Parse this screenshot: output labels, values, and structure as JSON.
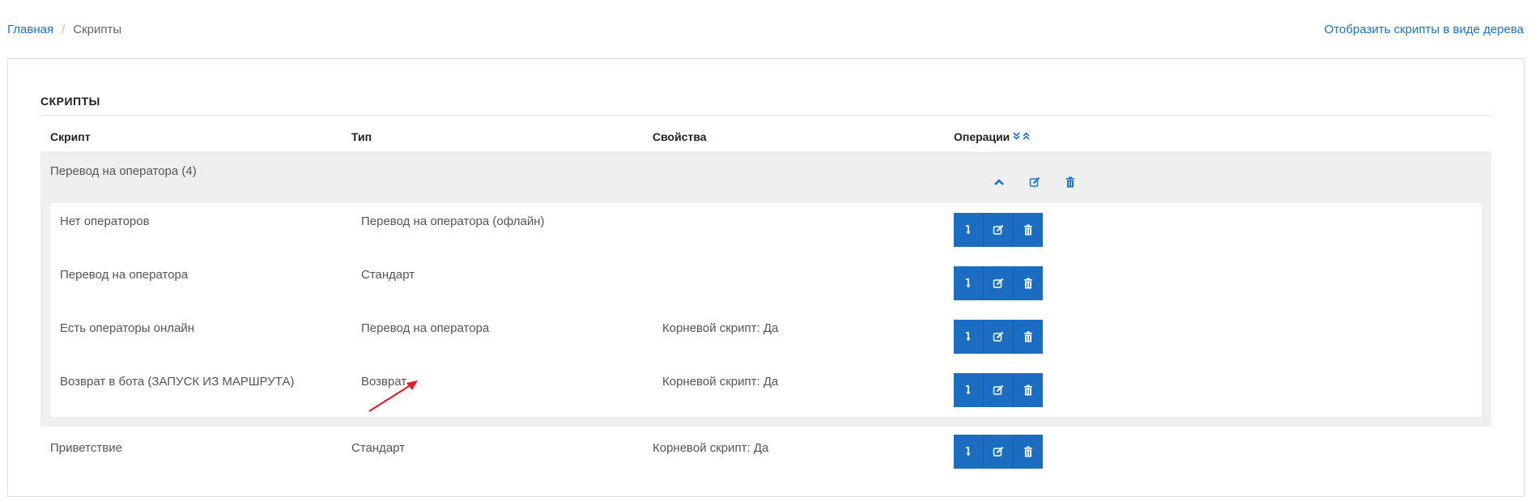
{
  "breadcrumb": {
    "home": "Главная",
    "current": "Скрипты"
  },
  "tree_link": "Отобразить скрипты в виде дерева",
  "card": {
    "title": "СКРИПТЫ"
  },
  "columns": {
    "script": "Скрипт",
    "type": "Тип",
    "properties": "Свойства",
    "operations": "Операции"
  },
  "group": {
    "name": "Перевод на оператора (4)",
    "children": [
      {
        "script": "Нет операторов",
        "type": "Перевод на оператора (офлайн)",
        "properties": ""
      },
      {
        "script": "Перевод на оператора",
        "type": "Стандарт",
        "properties": ""
      },
      {
        "script": "Есть операторы онлайн",
        "type": "Перевод на оператора",
        "properties": "Корневой скрипт: Да"
      },
      {
        "script": "Возврат в бота (ЗАПУСК ИЗ МАРШРУТА)",
        "type": "Возврат",
        "properties": "Корневой скрипт: Да"
      }
    ]
  },
  "rows": [
    {
      "script": "Приветствие",
      "type": "Стандарт",
      "properties": "Корневой скрипт: Да"
    }
  ],
  "icons": {
    "sort": "double-chevron-icons",
    "collapse": "chevron-up-icon",
    "edit": "edit-icon",
    "delete": "trash-icon",
    "move": "arrow-down-icon"
  },
  "colors": {
    "accent": "#1a73c8",
    "button": "#1a6dc1",
    "group_bg": "#efefef",
    "annotation_arrow": "#e02020"
  }
}
